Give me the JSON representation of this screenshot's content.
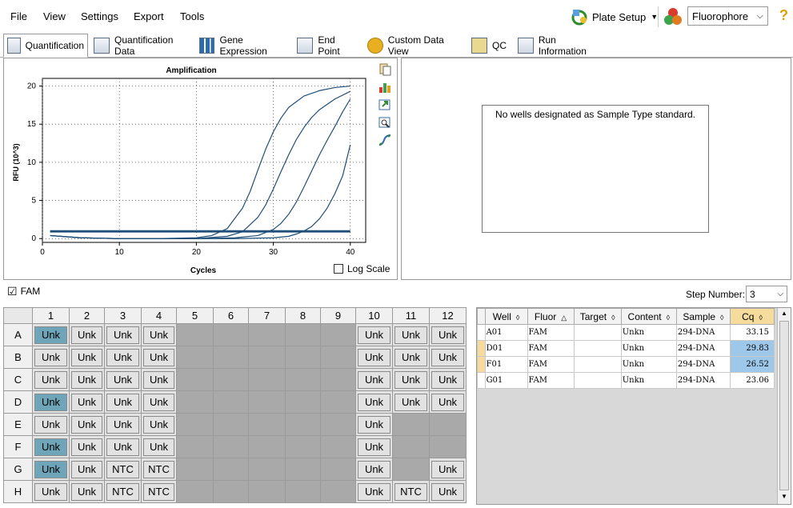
{
  "menu": {
    "file": "File",
    "view": "View",
    "settings": "Settings",
    "export": "Export",
    "tools": "Tools"
  },
  "toolbar": {
    "plate_setup": "Plate Setup",
    "fluorophore": "Fluorophore",
    "help": "?"
  },
  "tabs": [
    "Quantification",
    "Quantification Data",
    "Gene Expression",
    "End Point",
    "Custom Data View",
    "QC",
    "Run Information"
  ],
  "chart_data": {
    "type": "line",
    "title": "Amplification",
    "xlabel": "Cycles",
    "ylabel": "RFU (10^3)",
    "xlim": [
      0,
      42
    ],
    "ylim": [
      -0.5,
      21
    ],
    "xticks": [
      0,
      10,
      20,
      30,
      40
    ],
    "yticks": [
      0,
      5,
      10,
      15,
      20
    ],
    "log_scale_label": "Log Scale",
    "series": [
      {
        "x": [
          1,
          5,
          10,
          15,
          20,
          22,
          24,
          26,
          27,
          28,
          29,
          30,
          31,
          32,
          34,
          36,
          38,
          40
        ],
        "y": [
          0.4,
          0.1,
          0,
          0,
          0.1,
          0.4,
          1.3,
          4,
          6.2,
          9,
          11.7,
          14,
          15.8,
          17.2,
          18.7,
          19.4,
          19.8,
          20
        ]
      },
      {
        "x": [
          1,
          5,
          10,
          15,
          20,
          24,
          26,
          28,
          29,
          30,
          31,
          32,
          33,
          34,
          35,
          36,
          38,
          40
        ],
        "y": [
          0.4,
          0.1,
          0,
          0,
          0,
          0.3,
          0.9,
          2.8,
          4.4,
          6.5,
          8.8,
          11,
          13,
          14.6,
          15.9,
          16.9,
          18.3,
          19.3
        ]
      },
      {
        "x": [
          1,
          5,
          10,
          15,
          20,
          25,
          28,
          30,
          31,
          32,
          33,
          34,
          35,
          36,
          37,
          38,
          39,
          40
        ],
        "y": [
          0.4,
          0.1,
          0,
          0,
          0,
          0.1,
          0.4,
          1.2,
          2,
          3.2,
          4.8,
          6.8,
          8.9,
          11,
          12.9,
          14.7,
          16.6,
          18.3
        ]
      },
      {
        "x": [
          1,
          5,
          10,
          15,
          20,
          25,
          30,
          32,
          33,
          34,
          35,
          36,
          37,
          38,
          39,
          40
        ],
        "y": [
          0.4,
          0.1,
          0,
          0,
          0,
          0,
          0.1,
          0.3,
          0.6,
          1,
          1.6,
          2.6,
          4,
          5.9,
          8.2,
          12.3
        ]
      },
      {
        "x": [
          1,
          40
        ],
        "y": [
          0.9,
          0.9
        ]
      },
      {
        "x": [
          1,
          40
        ],
        "y": [
          1,
          1
        ]
      }
    ]
  },
  "standard": {
    "message": "No wells designated as Sample Type standard."
  },
  "fam": {
    "label": "FAM",
    "checked": "☑",
    "step_label": "Step Number:",
    "step_value": "3"
  },
  "plate": {
    "columns": [
      "1",
      "2",
      "3",
      "4",
      "5",
      "6",
      "7",
      "8",
      "9",
      "10",
      "11",
      "12"
    ],
    "rows": [
      {
        "label": "A",
        "cells": [
          "Unk",
          "Unk",
          "Unk",
          "Unk",
          "",
          "",
          "",
          "",
          "",
          "Unk",
          "Unk",
          "Unk"
        ],
        "sel": [
          1,
          0,
          0,
          0,
          0,
          0,
          0,
          0,
          0,
          0,
          0,
          0
        ]
      },
      {
        "label": "B",
        "cells": [
          "Unk",
          "Unk",
          "Unk",
          "Unk",
          "",
          "",
          "",
          "",
          "",
          "Unk",
          "Unk",
          "Unk"
        ],
        "sel": [
          0,
          0,
          0,
          0,
          0,
          0,
          0,
          0,
          0,
          0,
          0,
          0
        ]
      },
      {
        "label": "C",
        "cells": [
          "Unk",
          "Unk",
          "Unk",
          "Unk",
          "",
          "",
          "",
          "",
          "",
          "Unk",
          "Unk",
          "Unk"
        ],
        "sel": [
          0,
          0,
          0,
          0,
          0,
          0,
          0,
          0,
          0,
          0,
          0,
          0
        ]
      },
      {
        "label": "D",
        "cells": [
          "Unk",
          "Unk",
          "Unk",
          "Unk",
          "",
          "",
          "",
          "",
          "",
          "Unk",
          "Unk",
          "Unk"
        ],
        "sel": [
          1,
          0,
          0,
          0,
          0,
          0,
          0,
          0,
          0,
          0,
          0,
          0
        ]
      },
      {
        "label": "E",
        "cells": [
          "Unk",
          "Unk",
          "Unk",
          "Unk",
          "",
          "",
          "",
          "",
          "",
          "Unk",
          "",
          ""
        ],
        "sel": [
          0,
          0,
          0,
          0,
          0,
          0,
          0,
          0,
          0,
          0,
          0,
          0
        ]
      },
      {
        "label": "F",
        "cells": [
          "Unk",
          "Unk",
          "Unk",
          "Unk",
          "",
          "",
          "",
          "",
          "",
          "Unk",
          "",
          ""
        ],
        "sel": [
          1,
          0,
          0,
          0,
          0,
          0,
          0,
          0,
          0,
          0,
          0,
          0
        ]
      },
      {
        "label": "G",
        "cells": [
          "Unk",
          "Unk",
          "NTC",
          "NTC",
          "",
          "",
          "",
          "",
          "",
          "Unk",
          "",
          "Unk"
        ],
        "sel": [
          1,
          0,
          0,
          0,
          0,
          0,
          0,
          0,
          0,
          0,
          0,
          0
        ]
      },
      {
        "label": "H",
        "cells": [
          "Unk",
          "Unk",
          "NTC",
          "NTC",
          "",
          "",
          "",
          "",
          "",
          "Unk",
          "NTC",
          "Unk"
        ],
        "sel": [
          0,
          0,
          0,
          0,
          0,
          0,
          0,
          0,
          0,
          0,
          0,
          0
        ]
      }
    ]
  },
  "data_table": {
    "headers": [
      "Well",
      "Fluor",
      "Target",
      "Content",
      "Sample",
      "Cq"
    ],
    "rows": [
      {
        "well": "A01",
        "fluor": "FAM",
        "target": "",
        "content": "Unkn",
        "sample": "294-DNA",
        "cq": "33.15",
        "hl": false
      },
      {
        "well": "D01",
        "fluor": "FAM",
        "target": "",
        "content": "Unkn",
        "sample": "294-DNA",
        "cq": "29.83",
        "hl": true
      },
      {
        "well": "F01",
        "fluor": "FAM",
        "target": "",
        "content": "Unkn",
        "sample": "294-DNA",
        "cq": "26.52",
        "hl": true
      },
      {
        "well": "G01",
        "fluor": "FAM",
        "target": "",
        "content": "Unkn",
        "sample": "294-DNA",
        "cq": "23.06",
        "hl": false
      }
    ]
  },
  "colors": {
    "curve": "#1f4e79",
    "threshold": "#1f4e79",
    "selected_well": "#6fa5b8",
    "cq_highlight": "#9ec8ea"
  }
}
